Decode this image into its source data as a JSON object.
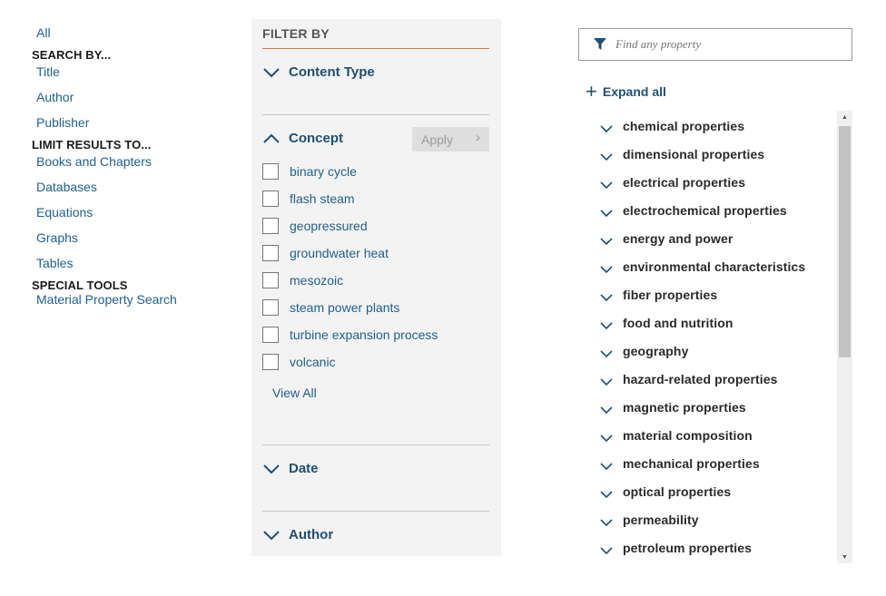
{
  "nav": {
    "all": "All",
    "search_by_heading": "SEARCH BY...",
    "search_by": [
      "Title",
      "Author",
      "Publisher"
    ],
    "limit_heading": "LIMIT RESULTS TO...",
    "limit": [
      "Books and Chapters",
      "Databases",
      "Equations",
      "Graphs",
      "Tables"
    ],
    "tools_heading": "SPECIAL TOOLS",
    "tools": [
      "Material Property Search"
    ]
  },
  "filter": {
    "title": "FILTER BY",
    "content_type": "Content Type",
    "concept": "Concept",
    "apply": "Apply",
    "concepts": [
      "binary cycle",
      "flash steam",
      "geopressured",
      "groundwater heat",
      "mesozoic",
      "steam power plants",
      "turbine expansion process",
      "volcanic"
    ],
    "view_all": "View All",
    "date": "Date",
    "author": "Author"
  },
  "properties": {
    "search_placeholder": "Find any property",
    "expand_all": "Expand all",
    "items": [
      "chemical properties",
      "dimensional properties",
      "electrical properties",
      "electrochemical properties",
      "energy and power",
      "environmental characteristics",
      "fiber properties",
      "food and nutrition",
      "geography",
      "hazard-related properties",
      "magnetic properties",
      "material composition",
      "mechanical properties",
      "optical properties",
      "permeability",
      "petroleum properties"
    ]
  },
  "colors": {
    "link": "#1f5f8b",
    "heading_blue": "#1f4f73",
    "filter_bg": "#f3f3f3",
    "filter_rule": "#c87d3a"
  },
  "icons": {
    "section_collapsed": "chevron-down-icon",
    "section_expanded": "chevron-up-icon",
    "apply": "chevron-right-icon",
    "search": "filter-funnel-icon",
    "expand": "plus-icon",
    "property": "chevron-down-icon"
  }
}
